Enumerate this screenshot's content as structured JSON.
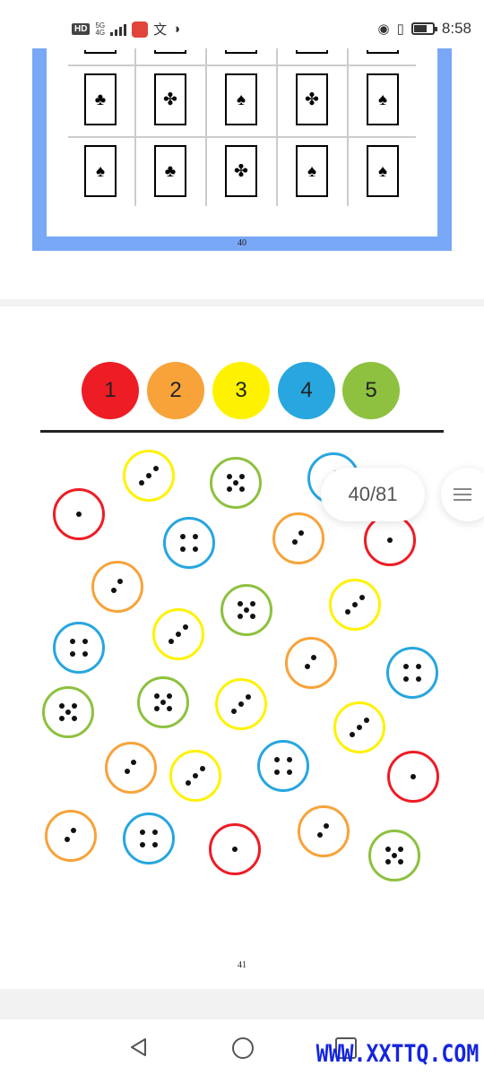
{
  "status_bar": {
    "hd": "HD",
    "network": "5G",
    "network_sub": "4G",
    "time": "8:58",
    "icons": [
      "signal-icon",
      "app-icon",
      "translate-icon",
      "browser-icon",
      "eye-icon",
      "vibrate-icon",
      "battery-icon"
    ],
    "battery_level": 0.8
  },
  "page40": {
    "page_number": "40",
    "frame_color": "#79a8f6",
    "top_row_suits": [
      "",
      "",
      "",
      "",
      ""
    ],
    "rows": [
      [
        "♣",
        "✤",
        "♠",
        "✤",
        "♠"
      ],
      [
        "♠",
        "♣",
        "✤",
        "♠",
        "♠"
      ]
    ]
  },
  "page41": {
    "page_number": "41",
    "badges": [
      {
        "label": "1",
        "color": "#ee1c25"
      },
      {
        "label": "2",
        "color": "#f7a33a"
      },
      {
        "label": "3",
        "color": "#fff200"
      },
      {
        "label": "4",
        "color": "#27a6df"
      },
      {
        "label": "5",
        "color": "#8dc13f"
      }
    ],
    "dice": [
      {
        "color": "#fff200",
        "count": 3
      },
      {
        "color": "#8dc13f",
        "count": 5
      },
      {
        "color": "#27a6df",
        "count": 2
      },
      {
        "color": "#ee1c25",
        "count": 1
      },
      {
        "color": "#27a6df",
        "count": 4
      },
      {
        "color": "#f7a33a",
        "count": 2
      },
      {
        "color": "#ee1c25",
        "count": 1
      },
      {
        "color": "#f7a33a",
        "count": 2
      },
      {
        "color": "#8dc13f",
        "count": 5
      },
      {
        "color": "#fff200",
        "count": 3
      },
      {
        "color": "#fff200",
        "count": 3
      },
      {
        "color": "#27a6df",
        "count": 4
      },
      {
        "color": "#f7a33a",
        "count": 2
      },
      {
        "color": "#27a6df",
        "count": 4
      },
      {
        "color": "#8dc13f",
        "count": 5
      },
      {
        "color": "#fff200",
        "count": 3
      },
      {
        "color": "#ee1c25",
        "count": 1
      },
      {
        "color": "#8dc13f",
        "count": 5
      },
      {
        "color": "#fff200",
        "count": 3
      },
      {
        "color": "#f7a33a",
        "count": 2
      },
      {
        "color": "#fff200",
        "count": 3
      },
      {
        "color": "#27a6df",
        "count": 4
      },
      {
        "color": "#f7a33a",
        "count": 2
      },
      {
        "color": "#27a6df",
        "count": 4
      },
      {
        "color": "#ee1c25",
        "count": 1
      },
      {
        "color": "#f7a33a",
        "count": 2
      },
      {
        "color": "#8dc13f",
        "count": 5
      }
    ]
  },
  "reader": {
    "page_indicator": "40/81"
  },
  "nav": {
    "icons": [
      "back-icon",
      "home-icon",
      "recent-apps-icon"
    ]
  },
  "watermark": "WWW.XXTTQ.COM"
}
